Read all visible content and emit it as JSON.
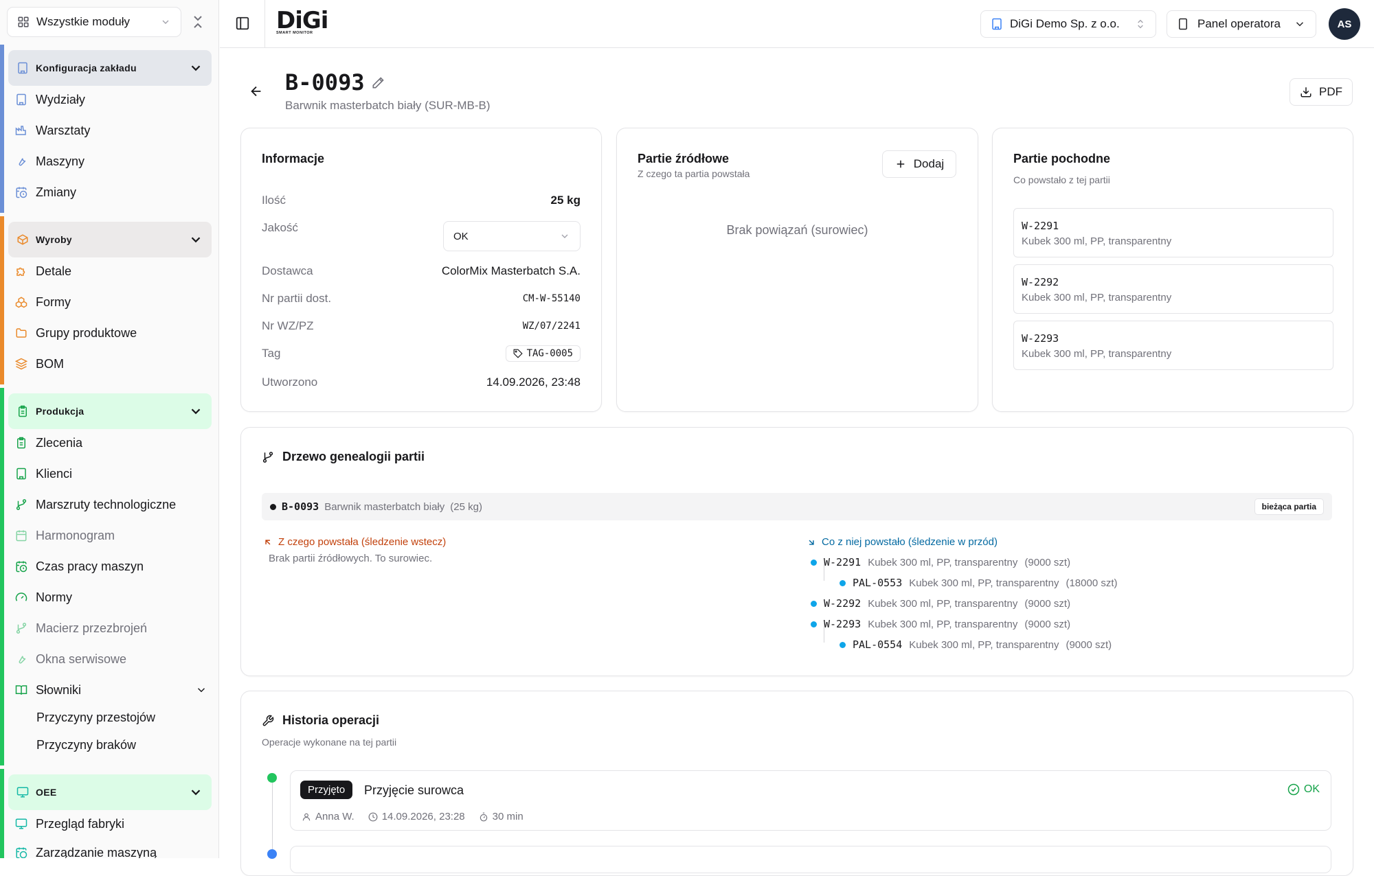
{
  "colors": {
    "accent_blue": "#6b8fd6",
    "accent_orange": "#ea8a2b",
    "accent_green": "#16a34a",
    "accent_teal": "#14b8a6",
    "trace_back": "#c2410c",
    "trace_forward": "#0369a1",
    "sky_dot": "#0ea5e9"
  },
  "sidebar": {
    "module_select": "Wszystkie moduły",
    "groups": [
      {
        "title": "Konfiguracja zakładu",
        "items": [
          {
            "label": "Wydziały",
            "icon": "building-icon"
          },
          {
            "label": "Warsztaty",
            "icon": "factory-icon"
          },
          {
            "label": "Maszyny",
            "icon": "wrench-icon"
          },
          {
            "label": "Zmiany",
            "icon": "calendar-clock-icon"
          }
        ]
      },
      {
        "title": "Wyroby",
        "items": [
          {
            "label": "Detale",
            "icon": "puzzle-icon"
          },
          {
            "label": "Formy",
            "icon": "boxes-icon"
          },
          {
            "label": "Grupy produktowe",
            "icon": "folder-icon"
          },
          {
            "label": "BOM",
            "icon": "layers-icon"
          }
        ]
      },
      {
        "title": "Produkcja",
        "items": [
          {
            "label": "Zlecenia",
            "icon": "clipboard-icon"
          },
          {
            "label": "Klienci",
            "icon": "building-icon"
          },
          {
            "label": "Marszruty technologiczne",
            "icon": "route-icon"
          },
          {
            "label": "Harmonogram",
            "icon": "calendar-icon"
          },
          {
            "label": "Czas pracy maszyn",
            "icon": "calendar-clock-icon"
          },
          {
            "label": "Normy",
            "icon": "gauge-icon"
          },
          {
            "label": "Macierz przezbrojeń",
            "icon": "route-icon"
          },
          {
            "label": "Okna serwisowe",
            "icon": "wrench-icon"
          },
          {
            "label": "Słowniki",
            "icon": "book-icon"
          }
        ],
        "sub_items": [
          "Przyczyny przestojów",
          "Przyczyny braków"
        ]
      },
      {
        "title": "OEE",
        "items": [
          {
            "label": "Przegląd fabryki",
            "icon": "monitor-icon"
          },
          {
            "label": "Zarządzanie maszyną",
            "icon": "calendar-clock-icon"
          }
        ]
      }
    ]
  },
  "topbar": {
    "logo_main": "DiGi",
    "logo_sub": "SMART MONITOR",
    "company": "DiGi Demo Sp. z o.o.",
    "panel": "Panel operatora",
    "avatar": "AS"
  },
  "page": {
    "title": "B-0093",
    "subtitle": "Barwnik masterbatch biały (SUR-MB-B)",
    "pdf_label": "PDF"
  },
  "info": {
    "title": "Informacje",
    "quantity_label": "Ilość",
    "quantity_value": "25 kg",
    "quality_label": "Jakość",
    "quality_value": "OK",
    "supplier_label": "Dostawca",
    "supplier_value": "ColorMix Masterbatch S.A.",
    "supplier_batch_label": "Nr partii dost.",
    "supplier_batch_value": "CM-W-55140",
    "wz_label": "Nr WZ/PZ",
    "wz_value": "WZ/07/2241",
    "tag_label": "Tag",
    "tag_value": "TAG-0005",
    "created_label": "Utworzono",
    "created_value": "14.09.2026, 23:48"
  },
  "sources": {
    "title": "Partie źródłowe",
    "subtitle": "Z czego ta partia powstała",
    "add_label": "Dodaj",
    "empty": "Brak powiązań (surowiec)"
  },
  "derived": {
    "title": "Partie pochodne",
    "subtitle": "Co powstało z tej partii",
    "items": [
      {
        "code": "W-2291",
        "desc": "Kubek 300 ml, PP, transparentny"
      },
      {
        "code": "W-2292",
        "desc": "Kubek 300 ml, PP, transparentny"
      },
      {
        "code": "W-2293",
        "desc": "Kubek 300 ml, PP, transparentny"
      }
    ]
  },
  "genealogy": {
    "title": "Drzewo genealogii partii",
    "current": {
      "code": "B-0093",
      "name": "Barwnik masterbatch biały",
      "qty": "(25 kg)",
      "badge": "bieżąca partia"
    },
    "backward_title": "Z czego powstała (śledzenie wstecz)",
    "backward_empty": "Brak partii źródłowych. To surowiec.",
    "forward_title": "Co z niej powstało (śledzenie w przód)",
    "forward": [
      {
        "code": "W-2291",
        "desc": "Kubek 300 ml, PP, transparentny",
        "qty": "(9000 szt)"
      },
      {
        "code": "PAL-0553",
        "desc": "Kubek 300 ml, PP, transparentny",
        "qty": "(18000 szt)"
      },
      {
        "code": "W-2292",
        "desc": "Kubek 300 ml, PP, transparentny",
        "qty": "(9000 szt)"
      },
      {
        "code": "W-2293",
        "desc": "Kubek 300 ml, PP, transparentny",
        "qty": "(9000 szt)"
      },
      {
        "code": "PAL-0554",
        "desc": "Kubek 300 ml, PP, transparentny",
        "qty": "(9000 szt)"
      }
    ]
  },
  "history": {
    "title": "Historia operacji",
    "subtitle": "Operacje wykonane na tej partii",
    "ops": [
      {
        "badge": "Przyjęto",
        "title": "Przyjęcie surowca",
        "status": "OK",
        "user": "Anna W.",
        "time": "14.09.2026, 23:28",
        "duration": "30 min"
      }
    ]
  }
}
